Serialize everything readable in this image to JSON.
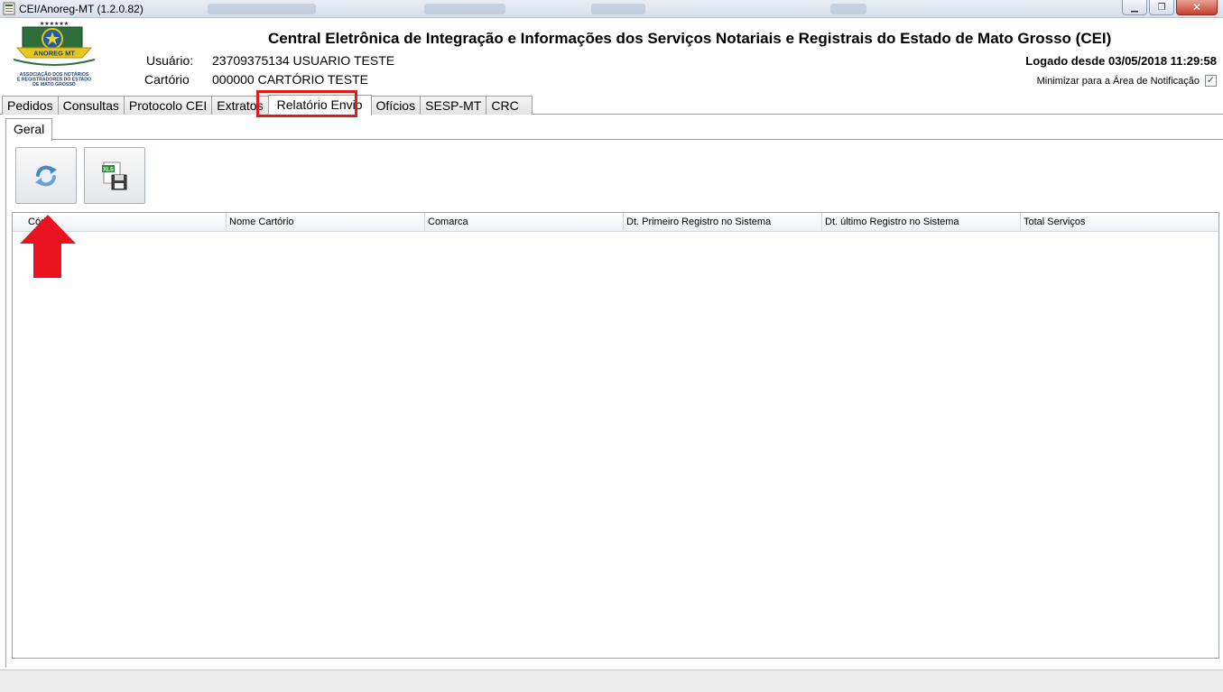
{
  "window": {
    "title": "CEI/Anoreg-MT (1.2.0.82)"
  },
  "header": {
    "title": "Central Eletrônica de Integração e Informações dos Serviços Notariais e Registrais do Estado de Mato Grosso (CEI)",
    "usuario_label": "Usuário:",
    "usuario_value": "23709375134 USUARIO TESTE",
    "cartorio_label": "Cartório",
    "cartorio_value": "000000 CARTÓRIO TESTE",
    "logged_since": "Logado desde 03/05/2018 11:29:58",
    "minimize_label": "Minimizar para a Área de Notificação",
    "minimize_checked": true
  },
  "logo": {
    "stars": "★★★★★★",
    "name": "ANOREG MT",
    "line1": "ASSOCIAÇÃO DOS NOTÁRIOS",
    "line2": "E REGISTRADORES DO ESTADO",
    "line3": "DE MATO GROSSO"
  },
  "tabs": [
    "Pedidos",
    "Consultas",
    "Protocolo CEI",
    "Extratos",
    "Relatório Envio",
    "Ofícios",
    "SESP-MT",
    "CRC"
  ],
  "active_tab": "Relatório Envio",
  "subtab": {
    "label": "Geral"
  },
  "toolbar": {
    "refresh_icon": "refresh-icon",
    "export_icon": "xls-save-icon",
    "export_badge": "XLS"
  },
  "grid": {
    "columns": [
      "Cód.",
      "Nome Cartório",
      "Comarca",
      "Dt. Primeiro Registro no Sistema",
      "Dt. último Registro no Sistema",
      "Total Serviços"
    ],
    "rows": []
  },
  "colors": {
    "highlight": "#e01b1b",
    "arrow": "#e8131f"
  }
}
